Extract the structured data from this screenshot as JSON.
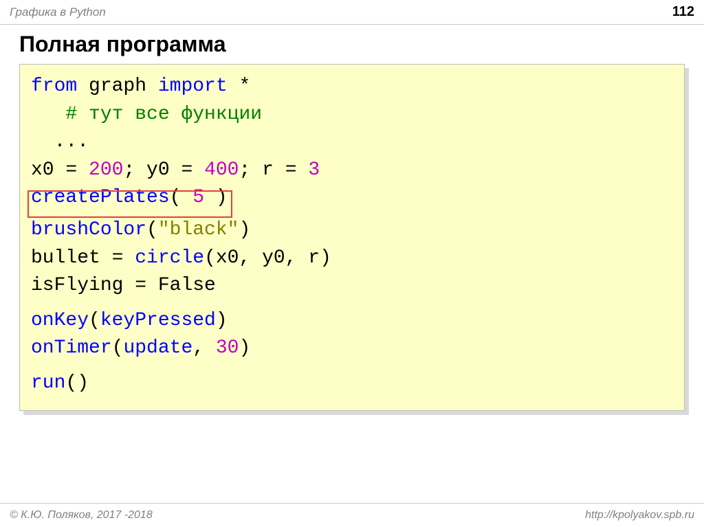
{
  "header": {
    "title": "Графика в Python",
    "page_number": "112"
  },
  "slide": {
    "title": "Полная программа"
  },
  "code": {
    "l1_from": "from",
    "l1_graph": " graph ",
    "l1_import": "import",
    "l1_star": " *",
    "l2_indent": "   ",
    "l2_comment": "# тут все функции",
    "l3_indent": "  ",
    "l3_dots": "...",
    "l4_a": "x0 = ",
    "l4_n1": "200",
    "l4_b": "; y0 = ",
    "l4_n2": "400",
    "l4_c": "; r = ",
    "l4_n3": "3",
    "l5_fn": "createPlates",
    "l5_open": "( ",
    "l5_arg": "5",
    "l5_close": " )",
    "l6_fn": "brushColor",
    "l6_open": "(",
    "l6_str": "\"black\"",
    "l6_close": ")",
    "l7_a": "bullet = ",
    "l7_fn": "circle",
    "l7_b": "(x0, y0, r)",
    "l8": "isFlying = False",
    "l9_fn": "onKey",
    "l9_open": "(",
    "l9_arg": "keyPressed",
    "l9_close": ")",
    "l10_fn": "onTimer",
    "l10_open": "(",
    "l10_arg1": "update",
    "l10_comma": ", ",
    "l10_arg2": "30",
    "l10_close": ")",
    "l11_fn": "run",
    "l11_par": "()"
  },
  "footer": {
    "copyright": "© К.Ю. Поляков, 2017 -2018",
    "url": "http://kpolyakov.spb.ru"
  }
}
